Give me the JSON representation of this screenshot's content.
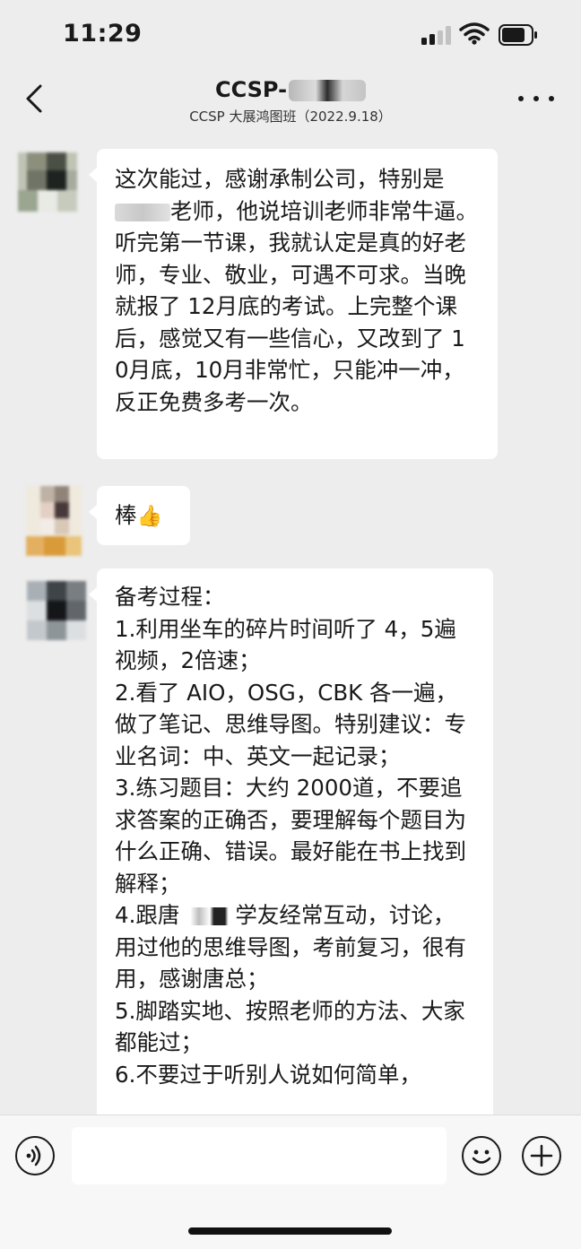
{
  "status_bar": {
    "time": "11:29"
  },
  "header": {
    "title_visible": "CCSP-",
    "subtitle": "CCSP 大展鸿图班（2022.9.18）",
    "back_icon": "chevron-left-icon",
    "more_icon": "more-dots-icon"
  },
  "messages": [
    {
      "parts": [
        "这次能过，感谢承制公司，特别是",
        "老师，他说培训老师非常牛逼。听完第一节课，我就认定是真的好老师，专业、敬业，可遇不可求。当晚就报了 12月底的考试。上完整个课后，感觉又有一些信心，又改到了 10月底，10月非常忙，只能冲一冲，反正免费多考一次。"
      ]
    },
    {
      "text": "棒",
      "emoji": "👍"
    },
    {
      "lines": [
        "备考过程：",
        "1.利用坐车的碎片时间听了 4，5遍视频，2倍速；",
        "2.看了 AIO，OSG，CBK 各一遍，做了笔记、思维导图。特别建议：专业名词：中、英文一起记录；",
        "3.练习题目：大约 2000道，不要追求答案的正确否，要理解每个题目为什么正确、错误。最好能在书上找到解释；"
      ],
      "line4_pre": "4.跟唐",
      "line4_post": "学友经常互动，讨论，用过他的思维导图，考前复习，很有用，感谢唐总；",
      "lines_after": [
        "5.脚踏实地、按照老师的方法、大家都能过；",
        "6.不要过于听别人说如何简单，"
      ]
    }
  ],
  "input_bar": {
    "placeholder": "",
    "voice_icon": "voice-icon",
    "emoji_icon": "smiley-icon",
    "plus_icon": "plus-icon"
  },
  "colors": {
    "background": "#ededed",
    "bubble": "#ffffff",
    "text": "#191919",
    "input_bar": "#f7f7f7"
  }
}
